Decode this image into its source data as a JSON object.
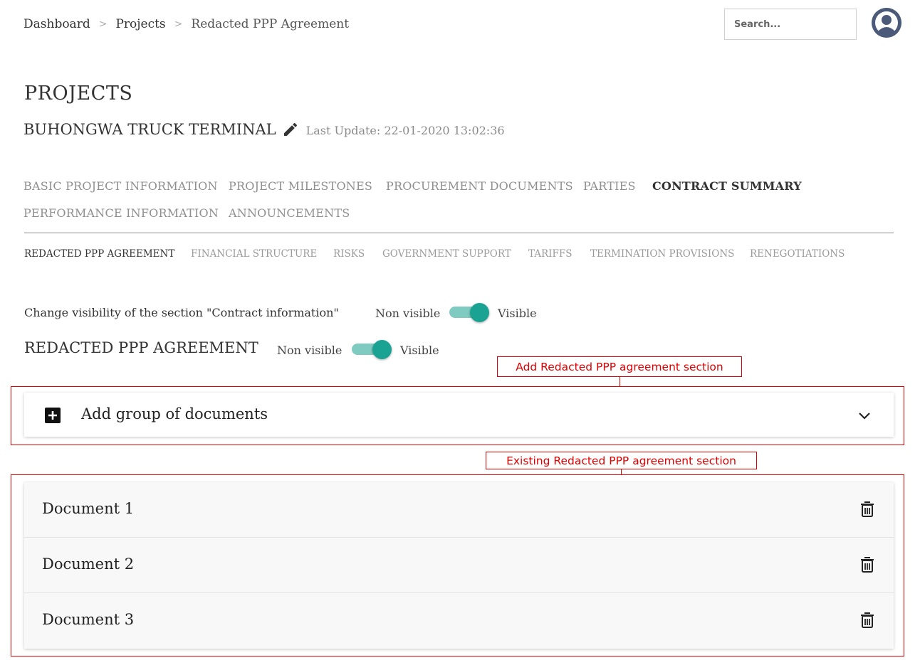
{
  "breadcrumb": {
    "items": [
      "Dashboard",
      "Projects",
      "Redacted PPP Agreement"
    ],
    "separator": ">"
  },
  "search": {
    "placeholder": "Search..."
  },
  "user": {
    "avatar_icon": "user-avatar-icon"
  },
  "page": {
    "title": "PROJECTS",
    "project_name": "BUHONGWA TRUCK TERMINAL",
    "last_update": "Last Update: 22-01-2020 13:02:36"
  },
  "tabs": {
    "row1": [
      "BASIC PROJECT INFORMATION",
      "PROJECT MILESTONES",
      "PROCUREMENT DOCUMENTS",
      "PARTIES",
      "CONTRACT SUMMARY"
    ],
    "row2": [
      "PERFORMANCE INFORMATION",
      "ANNOUNCEMENTS"
    ],
    "active": "CONTRACT SUMMARY"
  },
  "subtabs": {
    "items": [
      "REDACTED PPP AGREEMENT",
      "FINANCIAL STRUCTURE",
      "RISKS",
      "GOVERNMENT SUPPORT",
      "TARIFFS",
      "TERMINATION PROVISIONS",
      "RENEGOTIATIONS"
    ],
    "active": "REDACTED PPP AGREEMENT"
  },
  "visibility": {
    "contract_info_label": "Change visibility of the section \"Contract information\"",
    "non_visible": "Non visible",
    "visible": "Visible",
    "contract_info_on": true,
    "section_on": true
  },
  "section": {
    "title": "REDACTED PPP AGREEMENT",
    "add_group_label": "Add group of documents"
  },
  "annotations": {
    "add_callout": "Add Redacted PPP agreement section",
    "existing_callout": "Existing Redacted PPP agreement section",
    "color": "#e00000"
  },
  "documents": [
    {
      "label": "Document 1"
    },
    {
      "label": "Document 2"
    },
    {
      "label": "Document 3"
    }
  ],
  "colors": {
    "toggle_thumb": "#1aa393",
    "toggle_track": "#7fcbc1",
    "avatar_bg": "#4a5a78"
  }
}
